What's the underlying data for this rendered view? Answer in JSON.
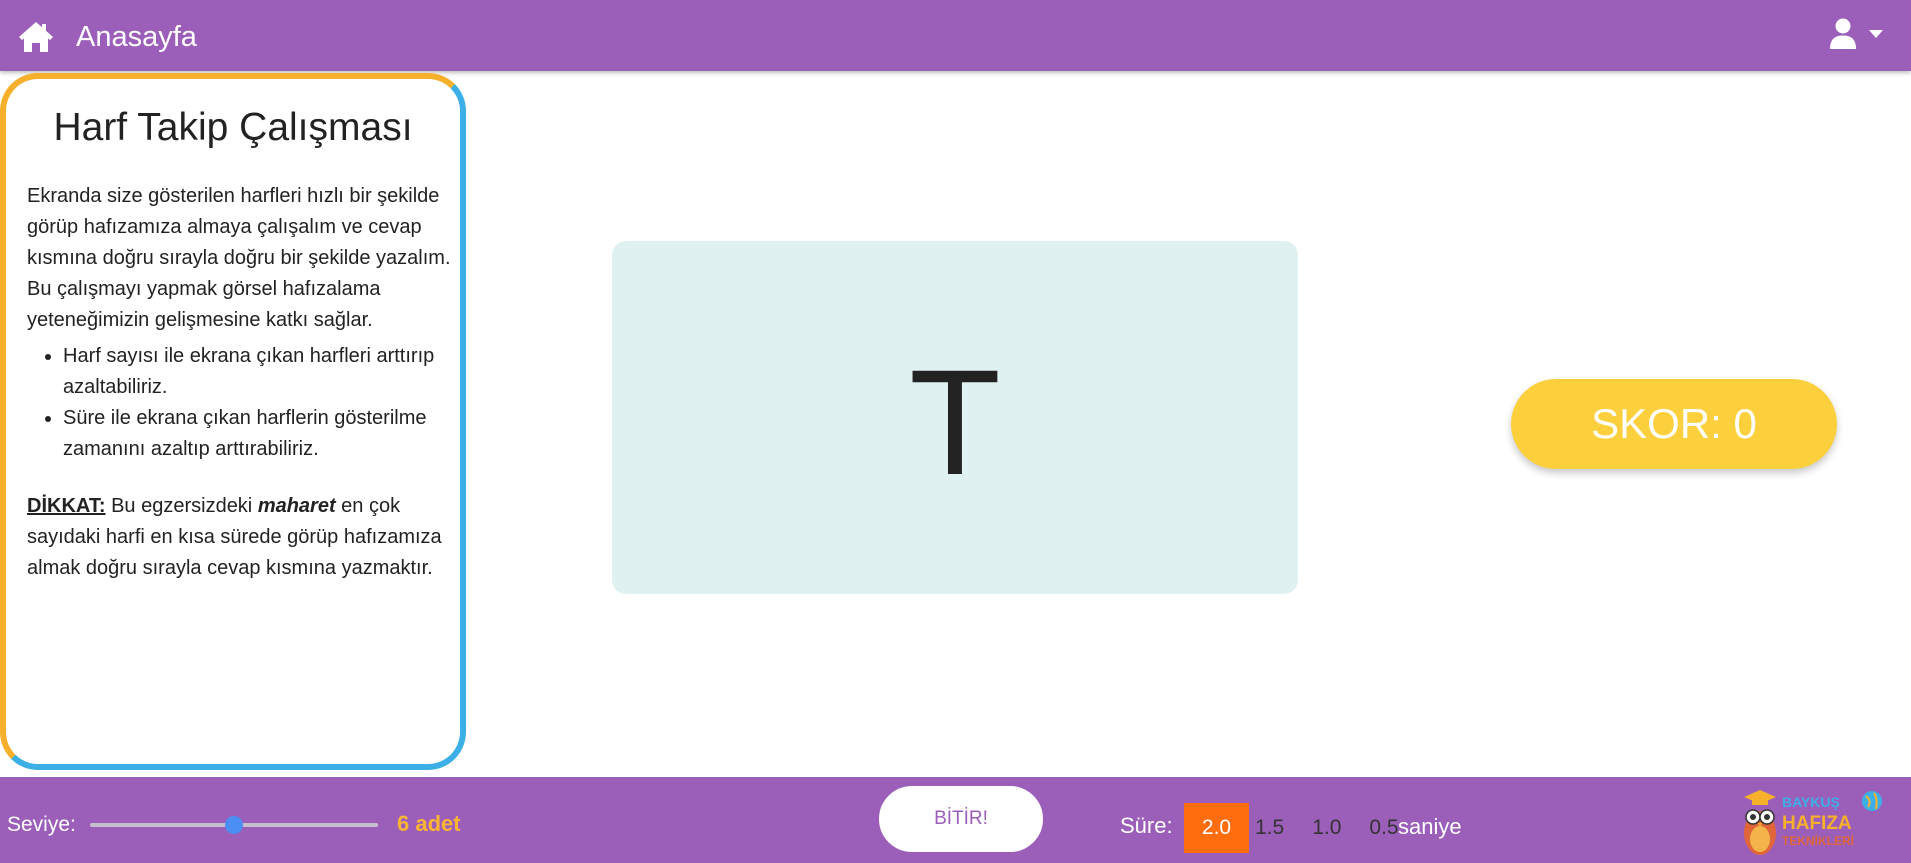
{
  "header": {
    "title": "Anasayfa",
    "home_icon": "home-icon",
    "user_icon": "user-icon",
    "caret_icon": "caret-down-icon",
    "background": "#9b5fba"
  },
  "info": {
    "title": "Harf Takip Çalışması",
    "paragraph": "Ekranda size gösterilen harfleri hızlı bir şekilde görüp hafızamıza almaya çalışalım ve cevap kısmına doğru sırayla doğru bir şekilde yazalım. Bu çalışmayı yapmak görsel hafızalama yeteneğimizin gelişmesine katkı sağlar.",
    "bullets": [
      "Harf sayısı ile ekrana çıkan harfleri arttırıp azaltabiliriz.",
      "Süre ile ekrana çıkan harflerin gösterilme zamanını azaltıp arttırabiliriz."
    ],
    "note_label": "DİKKAT:",
    "note_pre": " Bu egzersizdeki ",
    "note_em": "maharet",
    "note_post": " en çok sayıdaki harfi en kısa sürede görüp hafızamıza almak doğru sırayla cevap kısmına yazmaktır.",
    "border_colors": [
      "#f6b02c",
      "#3cb0e6"
    ]
  },
  "game": {
    "letter": "T",
    "card_color": "#e0f1f1",
    "score_text": "SKOR: 0",
    "score_color": "#fbd03c"
  },
  "footer": {
    "level_label": "Seviye:",
    "level_fraction": 0.5,
    "level_value": "6 adet",
    "finish_label": "BİTİR!",
    "time_label": "Süre:",
    "time_options": [
      "2.0",
      "1.5",
      "1.0",
      "0.5"
    ],
    "time_selected": "2.0",
    "time_unit": "saniye",
    "accent_orange": "#ff6d0e",
    "level_value_color": "#fbb534"
  },
  "brand": {
    "line1": "BAYKUŞ",
    "line2": "HAFIZA",
    "line3": "TEKNİKLERİ"
  }
}
